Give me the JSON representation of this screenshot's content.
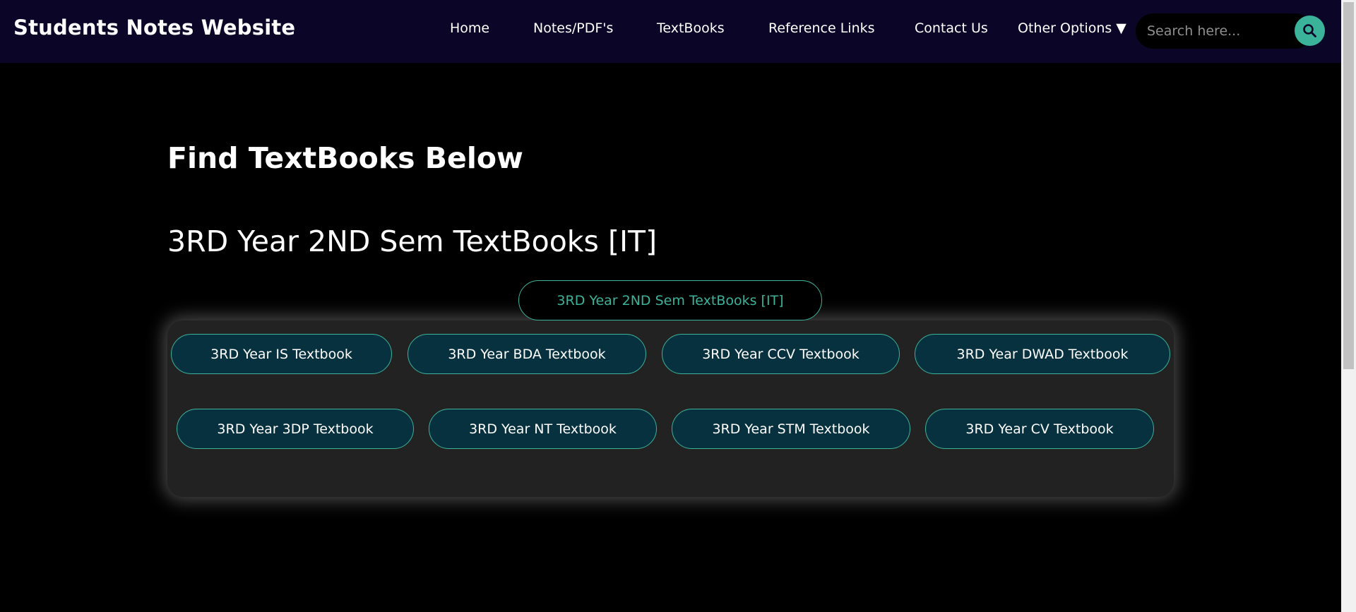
{
  "header": {
    "brand": "Students Notes Website",
    "nav": [
      {
        "label": "Home"
      },
      {
        "label": "Notes/PDF's"
      },
      {
        "label": "TextBooks"
      },
      {
        "label": "Reference Links"
      },
      {
        "label": "Contact Us"
      },
      {
        "label": "Other Options"
      }
    ],
    "dropdown_caret": "▼",
    "search": {
      "placeholder": "Search here..."
    }
  },
  "main": {
    "title": "Find TextBooks Below",
    "subtitle": "3RD Year 2ND Sem TextBooks [IT]",
    "toggle_label": "3RD Year 2ND Sem TextBooks [IT]",
    "textbooks": [
      {
        "label": "3RD Year IS Textbook"
      },
      {
        "label": "3RD Year BDA Textbook"
      },
      {
        "label": "3RD Year CCV Textbook"
      },
      {
        "label": "3RD Year DWAD Textbook"
      },
      {
        "label": "3RD Year 3DP Textbook"
      },
      {
        "label": "3RD Year NT Textbook"
      },
      {
        "label": "3RD Year STM Textbook"
      },
      {
        "label": "3RD Year CV Textbook"
      }
    ]
  },
  "colors": {
    "navbar_bg": "#0b0628",
    "accent": "#3bb39a",
    "button_bg": "#07313f",
    "panel_bg": "#222222",
    "page_bg": "#000000"
  }
}
